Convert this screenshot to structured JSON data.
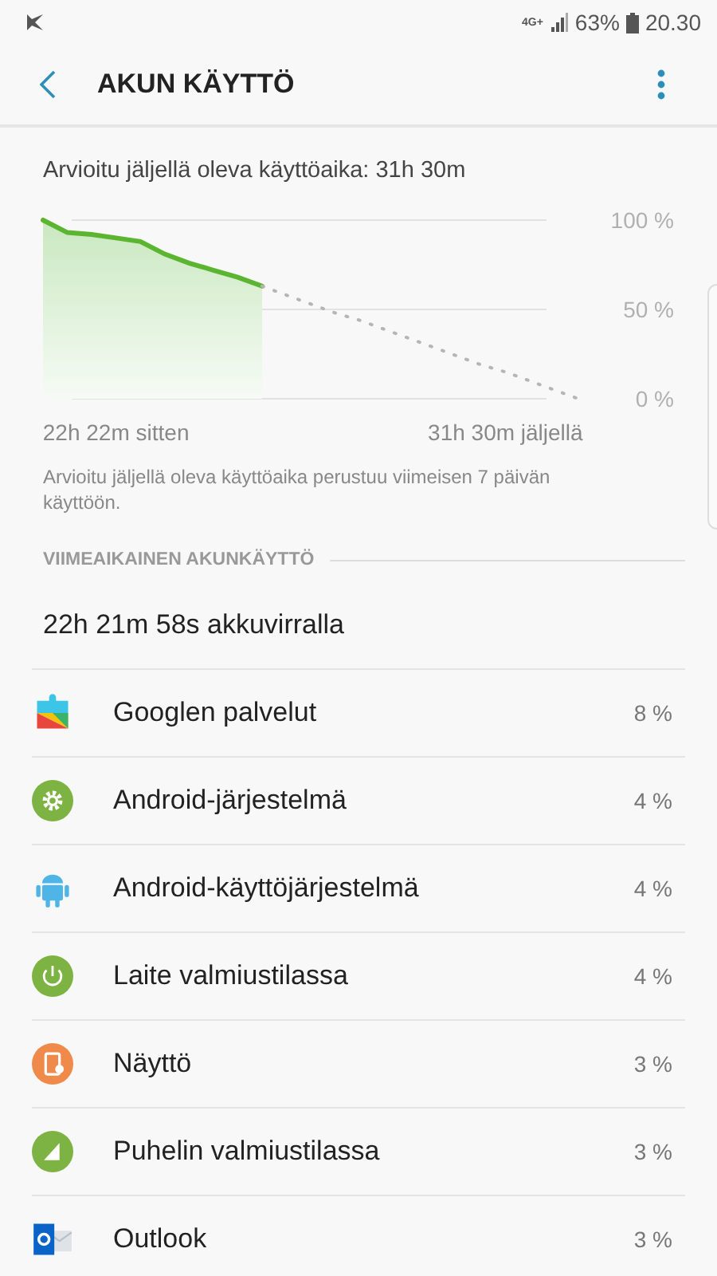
{
  "status_bar": {
    "network": "4G+",
    "battery": "63%",
    "time": "20.30"
  },
  "header": {
    "title": "AKUN KÄYTTÖ"
  },
  "estimate": "Arvioitu jäljellä oleva käyttöaika: 31h 30m",
  "chart": {
    "chart_data": {
      "type": "line",
      "categories": [
        null,
        null,
        null,
        "22h 22m sitten",
        null,
        null,
        null,
        null,
        null,
        null,
        null,
        null,
        null,
        null,
        null,
        null,
        null,
        null,
        null,
        "31h 30m jäljellä",
        null,
        null,
        null
      ],
      "series": [
        {
          "color": "#5cb531",
          "values": [
            100,
            93,
            92,
            90,
            88,
            81,
            76,
            72,
            68,
            63,
            null,
            null,
            null,
            null,
            null,
            null,
            null,
            null,
            null,
            null,
            null,
            null,
            null
          ]
        },
        {
          "color": "#b5b5b5",
          "line_style": "dotted",
          "values": [
            null,
            null,
            null,
            null,
            null,
            null,
            null,
            null,
            null,
            63,
            58,
            53,
            48,
            44,
            39,
            34,
            29,
            24,
            19,
            15,
            10,
            5,
            0
          ]
        }
      ],
      "ylim": [
        0,
        100
      ],
      "yticks": [
        {
          "value": 0,
          "label": "0 %"
        },
        {
          "value": 50,
          "label": "50 %"
        },
        {
          "value": 100,
          "label": "100 %"
        }
      ]
    }
  },
  "note": "Arvioitu jäljellä oleva käyttöaika perustuu viimeisen 7 päivän käyttöön.",
  "section_title": "VIIMEAIKAINEN AKUNKÄYTTÖ",
  "summary": "22h 21m 58s akkuvirralla",
  "apps": [
    {
      "kind": "puzzle",
      "name": "Googlen palvelut",
      "percent": "8 %"
    },
    {
      "kind": "gear",
      "name": "Android-järjestelmä",
      "percent": "4 %"
    },
    {
      "kind": "robot",
      "name": "Android-käyttöjärjestelmä",
      "percent": "4 %"
    },
    {
      "kind": "power",
      "name": "Laite valmiustilassa",
      "percent": "4 %"
    },
    {
      "kind": "screen",
      "name": "Näyttö",
      "percent": "3 %"
    },
    {
      "kind": "signal",
      "name": "Puhelin valmiustilassa",
      "percent": "3 %"
    },
    {
      "kind": "mail",
      "name": "Outlook",
      "percent": "3 %"
    }
  ]
}
